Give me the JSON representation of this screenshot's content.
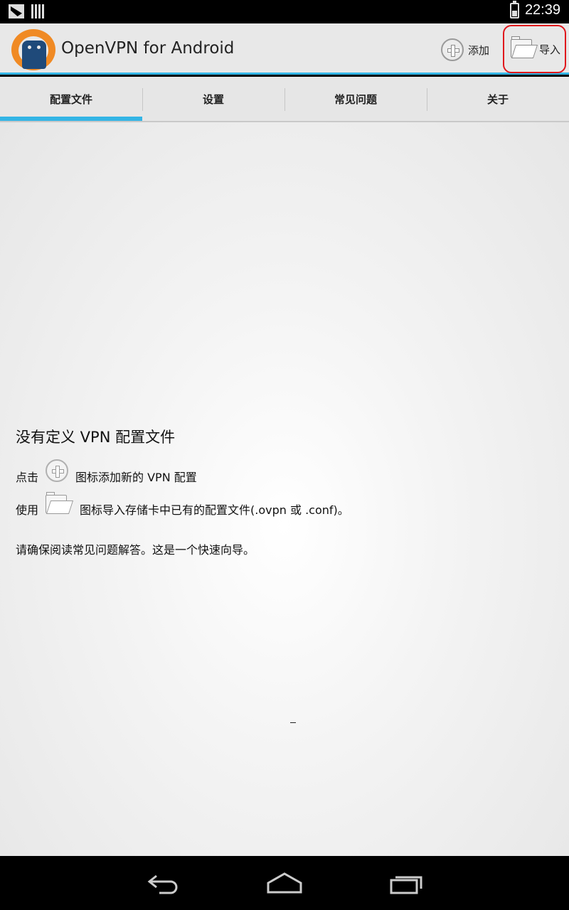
{
  "status_bar": {
    "time": "22:39"
  },
  "action_bar": {
    "title": "OpenVPN for Android",
    "add_label": "添加",
    "import_label": "导入"
  },
  "tabs": [
    {
      "label": "配置文件",
      "active": true
    },
    {
      "label": "设置",
      "active": false
    },
    {
      "label": "常见问题",
      "active": false
    },
    {
      "label": "关于",
      "active": false
    }
  ],
  "empty_state": {
    "title": "没有定义 VPN 配置文件",
    "line1_prefix": "点击",
    "line1_suffix": "图标添加新的 VPN 配置",
    "line2_prefix": "使用",
    "line2_suffix": "图标导入存储卡中已有的配置文件(.ovpn 或 .conf)。",
    "line3": "请确保阅读常见问题解答。这是一个快速向导。"
  },
  "colors": {
    "accent": "#33b5e5",
    "highlight_ring": "#e0161c",
    "logo_orange": "#f08a24"
  }
}
